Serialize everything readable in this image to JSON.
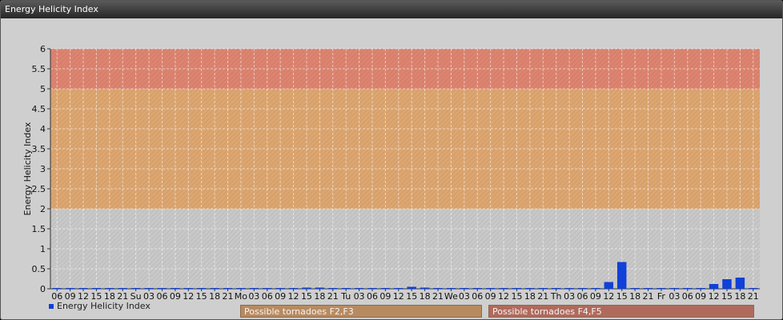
{
  "window": {
    "title": "Energy Helicity Index"
  },
  "legend": {
    "series_label": "Energy Helicity Index"
  },
  "bands": [
    {
      "label": "Possible tornadoes F2,F3",
      "from": 2,
      "to": 5,
      "color": "#e0a060"
    },
    {
      "label": "Possible tornadoes F4,F5",
      "from": 5,
      "to": 6,
      "color": "#e07860"
    }
  ],
  "colors": {
    "bar": "#1040d8",
    "background": "#c8c8c8"
  },
  "chart_data": {
    "type": "bar",
    "title": "",
    "xlabel": "",
    "ylabel": "Energy Helicity Index",
    "ylim": [
      0,
      6
    ],
    "yticks": [
      "0",
      "0.5",
      "1",
      "1.5",
      "2",
      "2.5",
      "3",
      "3.5",
      "4",
      "4.5",
      "5",
      "5.5",
      "6"
    ],
    "grid": true,
    "categories": [
      "06",
      "09",
      "12",
      "15",
      "18",
      "21",
      "Su",
      "03",
      "06",
      "09",
      "12",
      "15",
      "18",
      "21",
      "Mo",
      "03",
      "06",
      "09",
      "12",
      "15",
      "18",
      "21",
      "Tu",
      "03",
      "06",
      "09",
      "12",
      "15",
      "18",
      "21",
      "We",
      "03",
      "06",
      "09",
      "12",
      "15",
      "18",
      "21",
      "Th",
      "03",
      "06",
      "09",
      "12",
      "15",
      "18",
      "21",
      "Fr",
      "03",
      "06",
      "09",
      "12",
      "15",
      "18",
      "21"
    ],
    "series": [
      {
        "name": "Energy Helicity Index",
        "values": [
          0.02,
          0.02,
          0.02,
          0.02,
          0.02,
          0.02,
          0.02,
          0.02,
          0.02,
          0.02,
          0.02,
          0.02,
          0.02,
          0.02,
          0.02,
          0.02,
          0.02,
          0.02,
          0.02,
          0.03,
          0.03,
          0.02,
          0.02,
          0.02,
          0.02,
          0.02,
          0.02,
          0.05,
          0.03,
          0.02,
          0.02,
          0.02,
          0.02,
          0.02,
          0.02,
          0.02,
          0.02,
          0.02,
          0.02,
          0.02,
          0.02,
          0.02,
          0.17,
          0.67,
          0.02,
          0.02,
          0.02,
          0.02,
          0.02,
          0.02,
          0.12,
          0.24,
          0.28,
          0.02
        ]
      }
    ]
  }
}
